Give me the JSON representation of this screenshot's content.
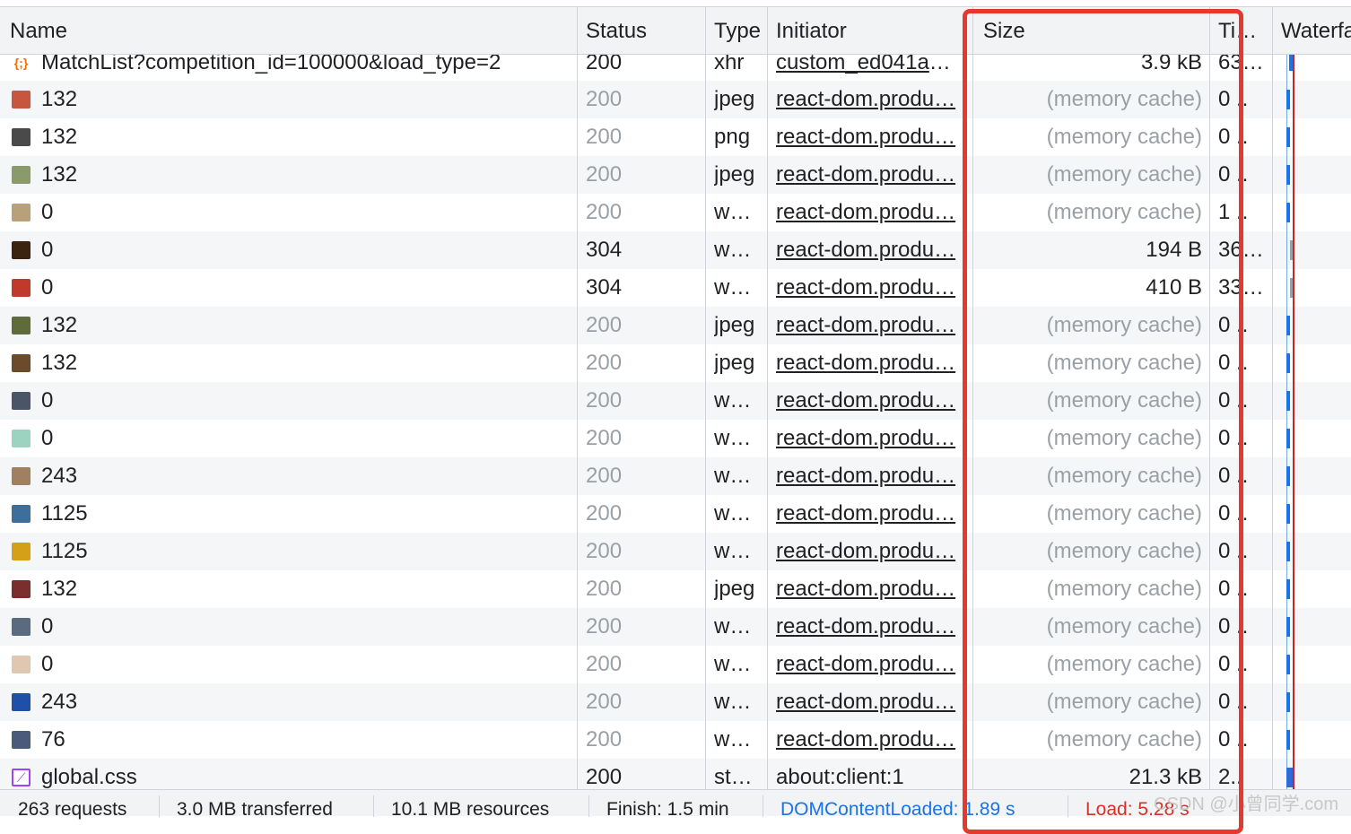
{
  "columns": {
    "name": "Name",
    "status": "Status",
    "type": "Type",
    "initiator": "Initiator",
    "size": "Size",
    "time": "Ti…",
    "waterfall": "Waterfa"
  },
  "rows": [
    {
      "icon": "json-icon",
      "name": "MatchList?competition_id=100000&load_type=2",
      "status": "200",
      "type": "xhr",
      "initiator": "custom_ed041a2…",
      "size": "3.9 kB",
      "time": "63…",
      "status_gray": false,
      "size_gray": false,
      "icon_color": "#e8710a"
    },
    {
      "icon": "image-thumbnail-icon",
      "name": "132",
      "status": "200",
      "type": "jpeg",
      "initiator": "react-dom.produ…",
      "size": "(memory cache)",
      "time": "0 ..",
      "status_gray": true,
      "size_gray": true,
      "icon_color": "#c8553d"
    },
    {
      "icon": "image-thumbnail-icon",
      "name": "132",
      "status": "200",
      "type": "png",
      "initiator": "react-dom.produ…",
      "size": "(memory cache)",
      "time": "0 ..",
      "status_gray": true,
      "size_gray": true,
      "icon_color": "#4a4a4a"
    },
    {
      "icon": "image-thumbnail-icon",
      "name": "132",
      "status": "200",
      "type": "jpeg",
      "initiator": "react-dom.produ…",
      "size": "(memory cache)",
      "time": "0 ..",
      "status_gray": true,
      "size_gray": true,
      "icon_color": "#8a9a6a"
    },
    {
      "icon": "image-thumbnail-icon",
      "name": "0",
      "status": "200",
      "type": "w…",
      "initiator": "react-dom.produ…",
      "size": "(memory cache)",
      "time": "1 ..",
      "status_gray": true,
      "size_gray": true,
      "icon_color": "#b8a078"
    },
    {
      "icon": "image-thumbnail-icon",
      "name": "0",
      "status": "304",
      "type": "w…",
      "initiator": "react-dom.produ…",
      "size": "194 B",
      "time": "36…",
      "status_gray": false,
      "size_gray": false,
      "icon_color": "#3a2410"
    },
    {
      "icon": "image-thumbnail-icon",
      "name": "0",
      "status": "304",
      "type": "w…",
      "initiator": "react-dom.produ…",
      "size": "410 B",
      "time": "33…",
      "status_gray": false,
      "size_gray": false,
      "icon_color": "#c0392b"
    },
    {
      "icon": "image-thumbnail-icon",
      "name": "132",
      "status": "200",
      "type": "jpeg",
      "initiator": "react-dom.produ…",
      "size": "(memory cache)",
      "time": "0 ..",
      "status_gray": true,
      "size_gray": true,
      "icon_color": "#5f6b3a"
    },
    {
      "icon": "image-thumbnail-icon",
      "name": "132",
      "status": "200",
      "type": "jpeg",
      "initiator": "react-dom.produ…",
      "size": "(memory cache)",
      "time": "0 ..",
      "status_gray": true,
      "size_gray": true,
      "icon_color": "#6b4b2a"
    },
    {
      "icon": "image-thumbnail-icon",
      "name": "0",
      "status": "200",
      "type": "w…",
      "initiator": "react-dom.produ…",
      "size": "(memory cache)",
      "time": "0 ..",
      "status_gray": true,
      "size_gray": true,
      "icon_color": "#4a5568"
    },
    {
      "icon": "image-thumbnail-icon",
      "name": "0",
      "status": "200",
      "type": "w…",
      "initiator": "react-dom.produ…",
      "size": "(memory cache)",
      "time": "0 ..",
      "status_gray": true,
      "size_gray": true,
      "icon_color": "#9bd3c0"
    },
    {
      "icon": "image-thumbnail-icon",
      "name": "243",
      "status": "200",
      "type": "w…",
      "initiator": "react-dom.produ…",
      "size": "(memory cache)",
      "time": "0 ..",
      "status_gray": true,
      "size_gray": true,
      "icon_color": "#a08060"
    },
    {
      "icon": "image-thumbnail-icon",
      "name": "1125",
      "status": "200",
      "type": "w…",
      "initiator": "react-dom.produ…",
      "size": "(memory cache)",
      "time": "0 ..",
      "status_gray": true,
      "size_gray": true,
      "icon_color": "#3d6f9a"
    },
    {
      "icon": "image-thumbnail-icon",
      "name": "1125",
      "status": "200",
      "type": "w…",
      "initiator": "react-dom.produ…",
      "size": "(memory cache)",
      "time": "0 ..",
      "status_gray": true,
      "size_gray": true,
      "icon_color": "#d4a017"
    },
    {
      "icon": "image-thumbnail-icon",
      "name": "132",
      "status": "200",
      "type": "jpeg",
      "initiator": "react-dom.produ…",
      "size": "(memory cache)",
      "time": "0 ..",
      "status_gray": true,
      "size_gray": true,
      "icon_color": "#7a2e2e"
    },
    {
      "icon": "image-thumbnail-icon",
      "name": "0",
      "status": "200",
      "type": "w…",
      "initiator": "react-dom.produ…",
      "size": "(memory cache)",
      "time": "0 ..",
      "status_gray": true,
      "size_gray": true,
      "icon_color": "#5a6b80"
    },
    {
      "icon": "image-thumbnail-icon",
      "name": "0",
      "status": "200",
      "type": "w…",
      "initiator": "react-dom.produ…",
      "size": "(memory cache)",
      "time": "0 ..",
      "status_gray": true,
      "size_gray": true,
      "icon_color": "#e0c8b0"
    },
    {
      "icon": "image-thumbnail-icon",
      "name": "243",
      "status": "200",
      "type": "w…",
      "initiator": "react-dom.produ…",
      "size": "(memory cache)",
      "time": "0 ..",
      "status_gray": true,
      "size_gray": true,
      "icon_color": "#1f4fa8"
    },
    {
      "icon": "image-thumbnail-icon",
      "name": "76",
      "status": "200",
      "type": "w…",
      "initiator": "react-dom.produ…",
      "size": "(memory cache)",
      "time": "0 ..",
      "status_gray": true,
      "size_gray": true,
      "icon_color": "#4a5a7a"
    },
    {
      "icon": "stylesheet-icon",
      "name": "global.css",
      "status": "200",
      "type": "st…",
      "initiator": "about:client:1",
      "size": "21.3 kB",
      "time": "2..",
      "status_gray": false,
      "size_gray": false,
      "icon_color": "#a142f4"
    }
  ],
  "initiator_plain_index": 19,
  "summary": {
    "requests": "263 requests",
    "transferred": "3.0 MB transferred",
    "resources": "10.1 MB resources",
    "finish": "Finish: 1.5 min",
    "domcontentloaded": "DOMContentLoaded: 1.89 s",
    "load": "Load: 5.28 s"
  },
  "watermark": "CSDN @小曾同学.com",
  "colors": {
    "highlight_box": "#e5392d",
    "link_blue": "#1a73e8",
    "load_red": "#d93025"
  }
}
